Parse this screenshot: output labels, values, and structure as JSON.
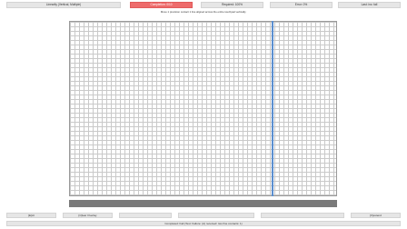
{
  "header": {
    "linearity": "Linearity (Vertical, Multiple)",
    "completion": "Completion: 0/10",
    "required": "Required: 100%",
    "error": "Error: 0%",
    "last": "Last: inc: fail"
  },
  "instruction": "Move 1 precision contact 1 line aligned across the entire touchpad vertically.",
  "footer": {
    "exit": "[E]xit",
    "clear_overlay": "[C]lear Overlay",
    "extend": "[X]extend",
    "status": "Completed: Fail (Test: Failure: (A) received: two fine contacts: 1)"
  },
  "colors": {
    "completion_badge": "#ee6b6b",
    "touch_line": "#5b8fd0",
    "progress_bar": "#7a7a7a"
  }
}
